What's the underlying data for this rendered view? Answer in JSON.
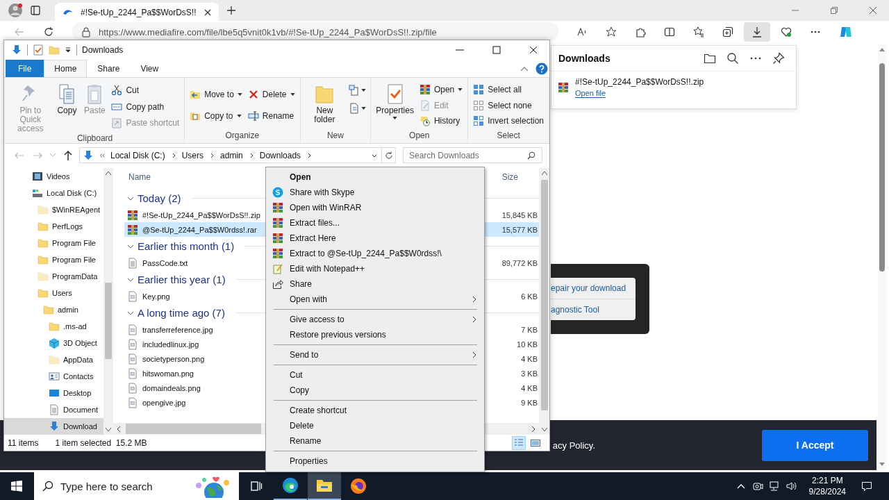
{
  "browser": {
    "tabs": [
      {
        "title": "#!Se-tUp_2244_Pa$$WorDsS!!",
        "selected": true
      }
    ],
    "url": "https://www.mediafire.com/file/lbe5q5vnit0k1vb/#!Se-tUp_2244_Pa$WorDsS!!.zip/file"
  },
  "page": {
    "dialog_links": [
      "epair your download",
      "agnostic Tool"
    ],
    "cookie_text": "acy Policy.",
    "accept_button": "I Accept"
  },
  "downloads_panel": {
    "title": "Downloads",
    "items": [
      {
        "name": "#!Se-tUp_2244_Pa$$WorDsS!!.zip",
        "action": "Open file"
      }
    ]
  },
  "explorer": {
    "title": "Downloads",
    "ribbon_tabs": [
      {
        "label": "File",
        "selected": false
      },
      {
        "label": "Home",
        "selected": true
      },
      {
        "label": "Share",
        "selected": false
      },
      {
        "label": "View",
        "selected": false
      }
    ],
    "ribbon": [
      {
        "kind": "clipboard",
        "label": "Clipboard",
        "items": [
          {
            "label": "Pin to Quick access",
            "kind": "large",
            "disabled": true,
            "dropdown": false
          },
          {
            "label": "Copy",
            "kind": "large",
            "disabled": false,
            "dropdown": false
          },
          {
            "label": "Paste",
            "kind": "large",
            "disabled": true,
            "dropdown": false
          },
          {
            "label": "Cut",
            "kind": "small",
            "disabled": false,
            "dropdown": false
          },
          {
            "label": "Copy path",
            "kind": "small",
            "disabled": false,
            "dropdown": false
          },
          {
            "label": "Paste shortcut",
            "kind": "small",
            "disabled": true,
            "dropdown": false
          }
        ]
      },
      {
        "kind": "organize",
        "label": "Organize",
        "items": [
          {
            "label": "Move to",
            "kind": "small",
            "disabled": false,
            "dropdown": true
          },
          {
            "label": "Copy to",
            "kind": "small",
            "disabled": false,
            "dropdown": true
          },
          {
            "label": "Delete",
            "kind": "small",
            "disabled": false,
            "dropdown": true
          },
          {
            "label": "Rename",
            "kind": "small",
            "disabled": false,
            "dropdown": false
          }
        ]
      },
      {
        "kind": "new",
        "label": "New",
        "items": [
          {
            "label": "New folder",
            "kind": "large",
            "disabled": false,
            "dropdown": false
          }
        ]
      },
      {
        "kind": "open",
        "label": "Open",
        "items": [
          {
            "label": "Properties",
            "kind": "large",
            "disabled": false,
            "dropdown": true
          },
          {
            "label": "Open",
            "kind": "small",
            "disabled": false,
            "dropdown": true
          },
          {
            "label": "Edit",
            "kind": "small",
            "disabled": true,
            "dropdown": false
          },
          {
            "label": "History",
            "kind": "small",
            "disabled": false,
            "dropdown": false
          }
        ]
      },
      {
        "kind": "select",
        "label": "Select",
        "items": [
          {
            "label": "Select all",
            "kind": "small",
            "disabled": false,
            "dropdown": false
          },
          {
            "label": "Select none",
            "kind": "small",
            "disabled": false,
            "dropdown": false
          },
          {
            "label": "Invert selection",
            "kind": "small",
            "disabled": false,
            "dropdown": false
          }
        ]
      }
    ],
    "breadcrumbs": [
      "Local Disk (C:)",
      "Users",
      "admin",
      "Downloads"
    ],
    "search_placeholder": "Search Downloads",
    "navigation": [
      {
        "label": "Videos",
        "kind": "videos",
        "selected": false,
        "hidden": false
      },
      {
        "label": "Local Disk (C:)",
        "kind": "drive",
        "selected": false,
        "hidden": false,
        "children": [
          {
            "label": "$WinREAgent",
            "kind": "folder",
            "selected": false,
            "hidden": true
          },
          {
            "label": "PerfLogs",
            "kind": "folder",
            "selected": false,
            "hidden": false
          },
          {
            "label": "Program File",
            "kind": "folder",
            "selected": false,
            "hidden": false
          },
          {
            "label": "Program File",
            "kind": "folder",
            "selected": false,
            "hidden": false
          },
          {
            "label": "ProgramData",
            "kind": "folder",
            "selected": false,
            "hidden": true
          },
          {
            "label": "Users",
            "kind": "folder",
            "selected": false,
            "hidden": false,
            "children": [
              {
                "label": "admin",
                "kind": "folder",
                "selected": false,
                "hidden": false,
                "children": [
                  {
                    "label": ".ms-ad",
                    "kind": "folder",
                    "selected": false,
                    "hidden": false
                  },
                  {
                    "label": "3D Object",
                    "kind": "cube",
                    "selected": false,
                    "hidden": false
                  },
                  {
                    "label": "AppData",
                    "kind": "folder",
                    "selected": false,
                    "hidden": true
                  },
                  {
                    "label": "Contacts",
                    "kind": "contacts",
                    "selected": false,
                    "hidden": false
                  },
                  {
                    "label": "Desktop",
                    "kind": "desktop",
                    "selected": false,
                    "hidden": false
                  },
                  {
                    "label": "Document",
                    "kind": "documents",
                    "selected": false,
                    "hidden": false
                  },
                  {
                    "label": "Download",
                    "kind": "downloads",
                    "selected": true,
                    "hidden": false
                  }
                ]
              }
            ]
          }
        ]
      }
    ],
    "columns": [
      "Name",
      "Size"
    ],
    "groups": [
      {
        "label": "Today (2)",
        "expanded": true,
        "files": [
          {
            "name": "#!Se-tUp_2244_Pa$$WorDsS!!.zip",
            "kind": "archive",
            "size": "15,845 KB",
            "selected": false
          },
          {
            "name": "@Se-tUp_2244_Pa$$W0rdss!.rar",
            "kind": "archive",
            "size": "15,577 KB",
            "selected": true
          }
        ]
      },
      {
        "label": "Earlier this month (1)",
        "expanded": true,
        "files": [
          {
            "name": "PassCode.txt",
            "kind": "text",
            "size": "89,772 KB",
            "selected": false
          }
        ]
      },
      {
        "label": "Earlier this year (1)",
        "expanded": true,
        "files": [
          {
            "name": "Key.png",
            "kind": "image",
            "size": "6 KB",
            "selected": false
          }
        ]
      },
      {
        "label": "A long time ago (7)",
        "expanded": true,
        "files": [
          {
            "name": "transferreference.jpg",
            "kind": "image",
            "size": "7 KB",
            "selected": false
          },
          {
            "name": "includedlinux.jpg",
            "kind": "image",
            "size": "10 KB",
            "selected": false
          },
          {
            "name": "societyperson.png",
            "kind": "image",
            "size": "4 KB",
            "selected": false
          },
          {
            "name": "hitswoman.png",
            "kind": "image",
            "size": "3 KB",
            "selected": false
          },
          {
            "name": "domaindeals.png",
            "kind": "image",
            "size": "4 KB",
            "selected": false
          },
          {
            "name": "opengive.jpg",
            "kind": "image",
            "size": "9 KB",
            "selected": false
          }
        ]
      }
    ],
    "status_items": "11 items",
    "status_selection": "1 item selected  15.2 MB"
  },
  "context_menu": [
    {
      "kind": "item",
      "label": "Open",
      "default": true,
      "submenu": false
    },
    {
      "kind": "item",
      "label": "Share with Skype",
      "default": false,
      "submenu": false
    },
    {
      "kind": "item",
      "label": "Open with WinRAR",
      "default": false,
      "submenu": false
    },
    {
      "kind": "item",
      "label": "Extract files...",
      "default": false,
      "submenu": false
    },
    {
      "kind": "item",
      "label": "Extract Here",
      "default": false,
      "submenu": false
    },
    {
      "kind": "item",
      "label": "Extract to @Se-tUp_2244_Pa$$W0rdss!\\",
      "default": false,
      "submenu": false
    },
    {
      "kind": "item",
      "label": "Edit with Notepad++",
      "default": false,
      "submenu": false
    },
    {
      "kind": "item",
      "label": "Share",
      "default": false,
      "submenu": false
    },
    {
      "kind": "item",
      "label": "Open with",
      "default": false,
      "submenu": true
    },
    {
      "kind": "separator"
    },
    {
      "kind": "item",
      "label": "Give access to",
      "default": false,
      "submenu": true
    },
    {
      "kind": "item",
      "label": "Restore previous versions",
      "default": false,
      "submenu": false
    },
    {
      "kind": "separator"
    },
    {
      "kind": "item",
      "label": "Send to",
      "default": false,
      "submenu": true
    },
    {
      "kind": "separator"
    },
    {
      "kind": "item",
      "label": "Cut",
      "default": false,
      "submenu": false
    },
    {
      "kind": "item",
      "label": "Copy",
      "default": false,
      "submenu": false
    },
    {
      "kind": "separator"
    },
    {
      "kind": "item",
      "label": "Create shortcut",
      "default": false,
      "submenu": false
    },
    {
      "kind": "item",
      "label": "Delete",
      "default": false,
      "submenu": false
    },
    {
      "kind": "item",
      "label": "Rename",
      "default": false,
      "submenu": false
    },
    {
      "kind": "separator"
    },
    {
      "kind": "item",
      "label": "Properties",
      "default": false,
      "submenu": false
    }
  ],
  "taskbar": {
    "search_placeholder": "Type here to search",
    "apps": [
      {
        "kind": "taskview",
        "selected": false,
        "running": false
      },
      {
        "kind": "edge",
        "selected": false,
        "running": true
      },
      {
        "kind": "explorer",
        "selected": true,
        "running": true
      },
      {
        "kind": "firefox",
        "selected": false,
        "running": false
      }
    ],
    "time": "2:21 PM",
    "date": "9/28/2024"
  }
}
